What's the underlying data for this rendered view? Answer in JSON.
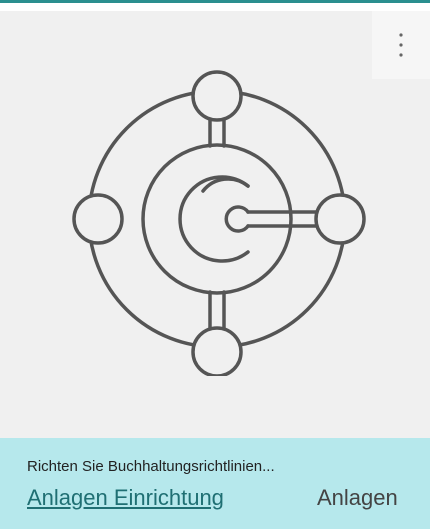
{
  "tile": {
    "icon": "connected-circles-logo",
    "more_icon": "vertical-ellipsis-icon",
    "description": "Richten Sie Buchhaltungsrichtlinien...",
    "link_label": "Anlagen Einrichtung",
    "category_label": "Anlagen",
    "colors": {
      "accent_rule": "#2a8f8f",
      "image_background": "#f0f0f0",
      "footer_background": "#b6e8ec",
      "link": "#1f6f73",
      "icon_stroke": "#555555"
    }
  }
}
